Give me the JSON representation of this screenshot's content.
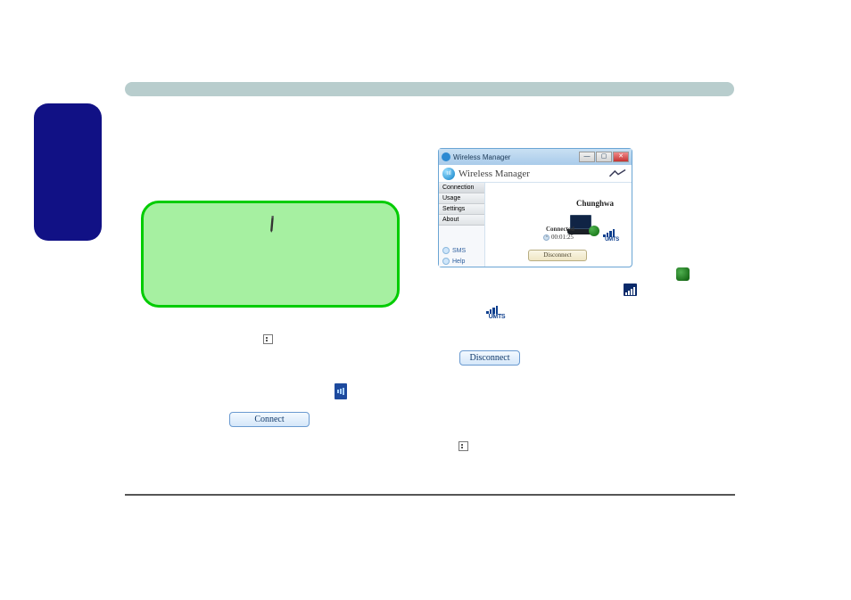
{
  "app": {
    "window_title": "Wireless Manager",
    "header_title": "Wireless Manager",
    "nav": {
      "connection": "Connection",
      "usage": "Usage",
      "settings": "Settings",
      "about": "About"
    },
    "side_links": {
      "sms": "SMS",
      "help": "Help"
    },
    "operator": "Chunghwa",
    "status": "Connected",
    "timer": "00:01:25",
    "net_type": "UMTS",
    "disconnect_btn": "Disconnect"
  },
  "body": {
    "net_type2": "UMTS",
    "connect_btn": "Connect",
    "disconnect_btn2": "Disconnect"
  },
  "titlebar": {
    "min": "—",
    "max": "▢",
    "close": "✕"
  }
}
